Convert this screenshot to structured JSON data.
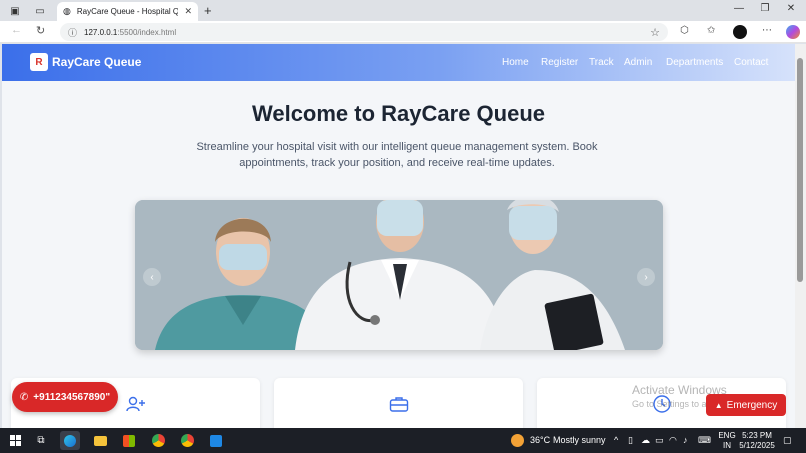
{
  "browser": {
    "tab_title": "RayCare Queue - Hospital Queue",
    "url_host": "127.0.0.1",
    "url_rest": ":5500/index.html"
  },
  "site": {
    "brand": "RayCare Queue",
    "nav": [
      "Home",
      "Register",
      "Track",
      "Admin",
      "Departments",
      "Contact"
    ]
  },
  "hero": {
    "title": "Welcome to RayCare Queue",
    "lead": "Streamline your hospital visit with our intelligent queue management system. Book appointments, track your position, and receive real-time updates."
  },
  "floating": {
    "phone_label": "+911234567890\"",
    "emergency_label": "Emergency"
  },
  "watermark": {
    "line1": "Activate Windows",
    "line2": "Go to Settings to activate Windows."
  },
  "taskbar": {
    "weather_temp": "36°C",
    "weather_desc": "Mostly sunny",
    "lang1": "ENG",
    "lang2": "IN",
    "time": "5:23 PM",
    "date": "5/12/2025"
  },
  "colors": {
    "accent": "#3b6fea",
    "danger": "#d92828",
    "card_icon": "#3b6fea"
  }
}
